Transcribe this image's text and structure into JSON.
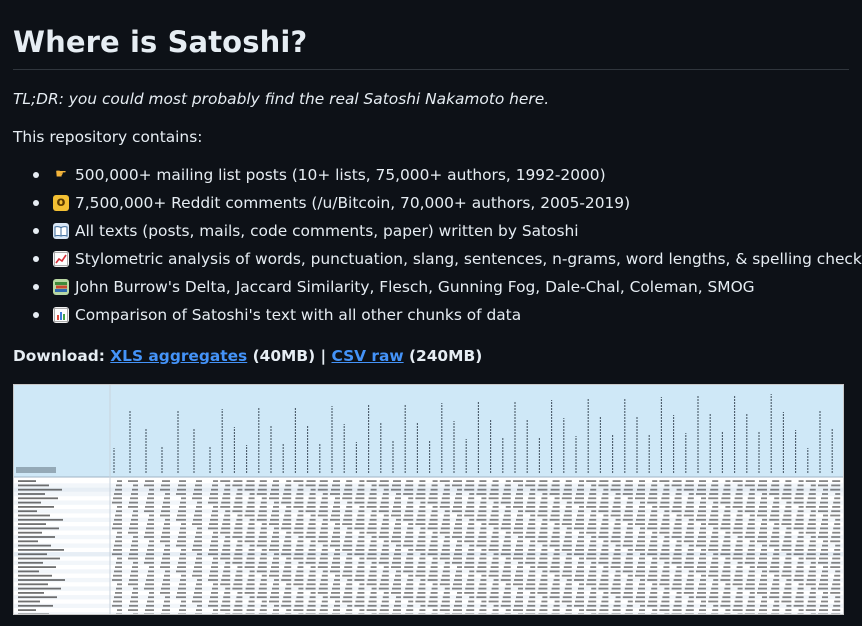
{
  "title": "Where is Satoshi?",
  "tldr": "TL;DR: you could most probably find the real Satoshi Nakamoto here.",
  "intro": "This repository contains:",
  "items": [
    {
      "icon": "pointing-hand-icon",
      "glyph": "👉",
      "text": "500,000+ mailing list posts (10+ lists, 75,000+ authors, 1992-2000)"
    },
    {
      "icon": "astonished-face-icon",
      "glyph": "😲",
      "text": "7,500,000+ Reddit comments (/u/Bitcoin, 70,000+ authors, 2005-2019)"
    },
    {
      "icon": "open-book-icon",
      "glyph": "📖",
      "text": "All texts (posts, mails, code comments, paper) written by Satoshi"
    },
    {
      "icon": "chart-increasing-icon",
      "glyph": "📈",
      "text": "Stylometric analysis of words, punctuation, slang, sentences, n-grams, word lengths, & spelling checks"
    },
    {
      "icon": "books-icon",
      "glyph": "📚",
      "text": "John Burrow's Delta, Jaccard Similarity, Flesch, Gunning Fog, Dale-Chal, Coleman, SMOG"
    },
    {
      "icon": "bar-chart-icon",
      "glyph": "📊",
      "text": "Comparison of Satoshi's text with all other chunks of data"
    }
  ],
  "download": {
    "label": "Download:",
    "xls_link": "XLS aggregates",
    "xls_size": "(40MB)",
    "separator": "|",
    "csv_link": "CSV raw",
    "csv_size": "(240MB)"
  },
  "colors": {
    "background": "#0d1117",
    "text": "#e6edf3",
    "link": "#4493f8",
    "sheet_header": "#cfe8f7"
  }
}
